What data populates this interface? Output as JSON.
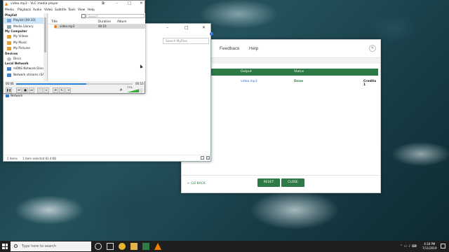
{
  "vlc": {
    "title": "video.mp3 - VLC media player",
    "menu": [
      "Media",
      "Playback",
      "Audio",
      "Video",
      "Subtitle",
      "Tools",
      "View",
      "Help"
    ],
    "sidebar": {
      "playlist_header": "Playlist",
      "items_playlist": [
        "Playlist [00:10]",
        "Media Library"
      ],
      "my_computer_header": "My Computer",
      "items_computer": [
        "My Videos",
        "My Music",
        "My Pictures"
      ],
      "devices_header": "Devices",
      "items_devices": [
        "Discs"
      ],
      "local_network_header": "Local Network",
      "items_network": [
        "mDNS Network Disco...",
        "Network streams (SAP)"
      ]
    },
    "filter_placeholder": "Search",
    "columns": [
      "Title",
      "Duration",
      "Album"
    ],
    "track": {
      "title": "video.mp3",
      "duration": "00:10"
    },
    "elapsed": "00:06",
    "total": "00:10",
    "progress": 0.6,
    "volume_label": "77%",
    "volume": 0.77
  },
  "explorer": {
    "search_placeholder": "Search MyFiles",
    "nav_network": "Network",
    "status": [
      "2 items",
      "1 item selected  83.4 KB"
    ]
  },
  "converter": {
    "tabs": [
      "Feedback",
      "Help"
    ],
    "columns": [
      "Output",
      "Status"
    ],
    "row": {
      "output": "video.mp3",
      "status": "Done",
      "credits": "Credits 1"
    },
    "go_back": "GO BACK",
    "reset": "RESET",
    "close": "CLOSE"
  },
  "taskbar": {
    "search_placeholder": "Type here to search",
    "time": "4:18 PM",
    "date": "7/11/2019"
  },
  "colors": {
    "green": "#2e7a46",
    "vlc_blue": "#2a82da",
    "volume_green": "#3aaa35"
  }
}
